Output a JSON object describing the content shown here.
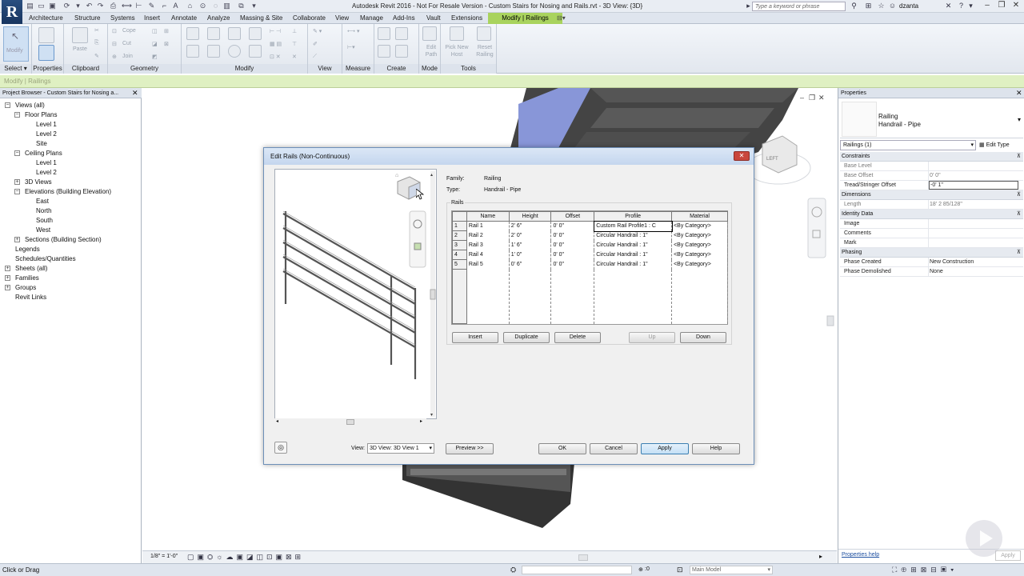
{
  "app": {
    "title": "Autodesk Revit 2016 - Not For Resale Version -    Custom Stairs for Nosing and Rails.rvt - 3D View: {3D}",
    "logo": "R",
    "search_placeholder": "Type a keyword or phrase",
    "user": "dzanta"
  },
  "tabs": [
    "Architecture",
    "Structure",
    "Systems",
    "Insert",
    "Annotate",
    "Analyze",
    "Massing & Site",
    "Collaborate",
    "View",
    "Manage",
    "Add-Ins",
    "Vault",
    "Extensions",
    "Modify | Railings"
  ],
  "ribbon": {
    "panels": [
      "Select",
      "Properties",
      "Clipboard",
      "Geometry",
      "Modify",
      "View",
      "Measure",
      "Create",
      "Mode",
      "Tools"
    ],
    "select_label": "Select ▾",
    "modify_btn": "Modify",
    "paste": "Paste",
    "cope": "Cope",
    "cut": "Cut",
    "join": "Join",
    "edit_path": "Edit Path",
    "pick_new_host": "Pick New Host",
    "reset_railing": "Reset Railing"
  },
  "context_label": "Modify | Railings",
  "project_browser": {
    "header": "Project Browser - Custom Stairs for Nosing a...",
    "items": [
      {
        "label": "Views (all)",
        "level": 0,
        "toggle": "−"
      },
      {
        "label": "Floor Plans",
        "level": 1,
        "toggle": "−"
      },
      {
        "label": "Level 1",
        "level": 2
      },
      {
        "label": "Level 2",
        "level": 2
      },
      {
        "label": "Site",
        "level": 2
      },
      {
        "label": "Ceiling Plans",
        "level": 1,
        "toggle": "−"
      },
      {
        "label": "Level 1",
        "level": 2
      },
      {
        "label": "Level 2",
        "level": 2
      },
      {
        "label": "3D Views",
        "level": 1,
        "toggle": "+"
      },
      {
        "label": "Elevations (Building Elevation)",
        "level": 1,
        "toggle": "−"
      },
      {
        "label": "East",
        "level": 2
      },
      {
        "label": "North",
        "level": 2
      },
      {
        "label": "South",
        "level": 2
      },
      {
        "label": "West",
        "level": 2
      },
      {
        "label": "Sections (Building Section)",
        "level": 1,
        "toggle": "+"
      },
      {
        "label": "Legends",
        "level": 0
      },
      {
        "label": "Schedules/Quantities",
        "level": 0
      },
      {
        "label": "Sheets (all)",
        "level": 0,
        "toggle": "+"
      },
      {
        "label": "Families",
        "level": 0,
        "toggle": "+"
      },
      {
        "label": "Groups",
        "level": 0,
        "toggle": "+"
      },
      {
        "label": "Revit Links",
        "level": 0
      }
    ]
  },
  "properties": {
    "header": "Properties",
    "type_name": "Railing",
    "type_sub": "Handrail - Pipe",
    "selector": "Railings (1)",
    "edit_type": "Edit Type",
    "rows": [
      {
        "kind": "section",
        "label": "Constraints"
      },
      {
        "kind": "row",
        "key": "Base Level",
        "value": ""
      },
      {
        "kind": "row",
        "key": "Base Offset",
        "value": "0'  0\""
      },
      {
        "kind": "row",
        "key": "Tread/Stringer Offset",
        "value": "-0'  1\""
      },
      {
        "kind": "section",
        "label": "Dimensions"
      },
      {
        "kind": "row",
        "key": "Length",
        "value": "18'  2 85/128\""
      },
      {
        "kind": "section",
        "label": "Identity Data"
      },
      {
        "kind": "row",
        "key": "Image",
        "value": ""
      },
      {
        "kind": "row",
        "key": "Comments",
        "value": ""
      },
      {
        "kind": "row",
        "key": "Mark",
        "value": ""
      },
      {
        "kind": "section",
        "label": "Phasing"
      },
      {
        "kind": "row",
        "key": "Phase Created",
        "value": "New Construction"
      },
      {
        "kind": "row",
        "key": "Phase Demolished",
        "value": "None"
      }
    ],
    "help_link": "Properties help",
    "apply": "Apply"
  },
  "dialog": {
    "title": "Edit Rails (Non-Continuous)",
    "close": "✕",
    "family_label": "Family:",
    "family_value": "Railing",
    "type_label": "Type:",
    "type_value": "Handrail - Pipe",
    "rails_label": "Rails",
    "columns": [
      "",
      "Name",
      "Height",
      "Offset",
      "Profile",
      "Material"
    ],
    "rows": [
      [
        "1",
        "Rail 1",
        "2'  6\"",
        "0'  0\"",
        "Custom Rail Profile1 : C",
        "<By Category>"
      ],
      [
        "2",
        "Rail 2",
        "2'  0\"",
        "0'  0\"",
        "Circular Handrail : 1\"",
        "<By Category>"
      ],
      [
        "3",
        "Rail 3",
        "1'  6\"",
        "0'  0\"",
        "Circular Handrail : 1\"",
        "<By Category>"
      ],
      [
        "4",
        "Rail 4",
        "1'  0\"",
        "0'  0\"",
        "Circular Handrail : 1\"",
        "<By Category>"
      ],
      [
        "5",
        "Rail 5",
        "0'  6\"",
        "0'  0\"",
        "Circular Handrail : 1\"",
        "<By Category>"
      ]
    ],
    "insert": "Insert",
    "duplicate": "Duplicate",
    "delete": "Delete",
    "up": "Up",
    "down": "Down",
    "view_label": "View:",
    "view_value": "3D View: 3D View 1",
    "preview": "Preview >>",
    "ok": "OK",
    "cancel": "Cancel",
    "apply": "Apply",
    "help": "Help"
  },
  "view_controls": {
    "scale": "1/8\" = 1'-0\""
  },
  "status": {
    "left": "Click or Drag",
    "zero": ":0",
    "model": "Main Model"
  }
}
